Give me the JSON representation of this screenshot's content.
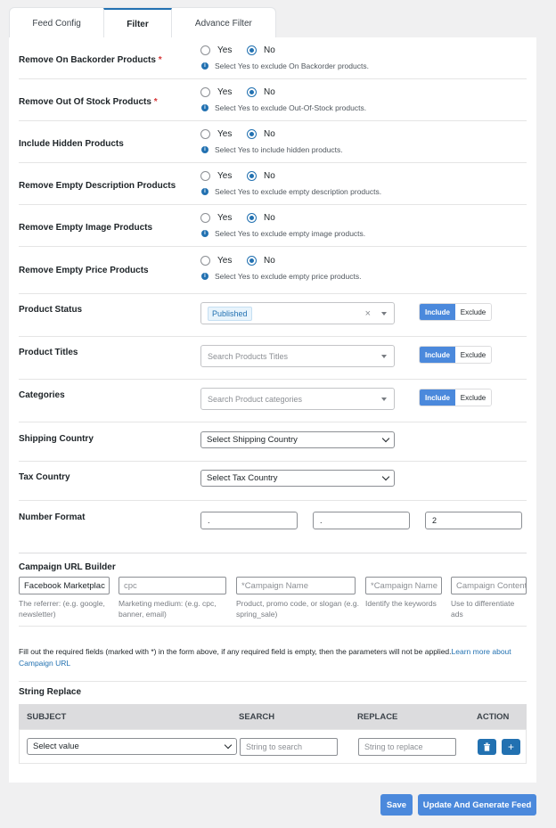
{
  "tabs": [
    "Feed Config",
    "Filter",
    "Advance Filter"
  ],
  "yes_no_rows": [
    {
      "label": "Remove On Backorder Products",
      "required": "*",
      "yes": "Yes",
      "no": "No",
      "selected": "No",
      "hint": "Select Yes to exclude On Backorder products."
    },
    {
      "label": "Remove Out Of Stock Products",
      "required": "*",
      "yes": "Yes",
      "no": "No",
      "selected": "No",
      "hint": "Select Yes to exclude Out-Of-Stock products."
    },
    {
      "label": "Include Hidden Products",
      "required": "",
      "yes": "Yes",
      "no": "No",
      "selected": "No",
      "hint": "Select Yes to include hidden products."
    },
    {
      "label": "Remove Empty Description Products",
      "required": "",
      "yes": "Yes",
      "no": "No",
      "selected": "No",
      "hint": "Select Yes to exclude empty description products."
    },
    {
      "label": "Remove Empty Image Products",
      "required": "",
      "yes": "Yes",
      "no": "No",
      "selected": "No",
      "hint": "Select Yes to exclude empty image products."
    },
    {
      "label": "Remove Empty Price Products",
      "required": "",
      "yes": "Yes",
      "no": "No",
      "selected": "No",
      "hint": "Select Yes to exclude empty price products."
    }
  ],
  "product_status": {
    "label": "Product Status",
    "tag": "Published",
    "clear": "×",
    "include": "Include",
    "exclude": "Exclude"
  },
  "product_titles": {
    "label": "Product Titles",
    "placeholder": "Search Products Titles",
    "include": "Include",
    "exclude": "Exclude"
  },
  "categories": {
    "label": "Categories",
    "placeholder": "Search Product categories",
    "include": "Include",
    "exclude": "Exclude"
  },
  "shipping_country": {
    "label": "Shipping Country",
    "value": "Select Shipping Country"
  },
  "tax_country": {
    "label": "Tax Country",
    "value": "Select Tax Country"
  },
  "number_format": {
    "label": "Number Format",
    "values": [
      ".",
      ".",
      "2"
    ]
  },
  "campaign": {
    "title": "Campaign URL Builder",
    "fields": [
      {
        "value": "Facebook Marketplac",
        "placeholder": "",
        "desc": "The referrer: (e.g. google, newsletter)"
      },
      {
        "value": "",
        "placeholder": "cpc",
        "desc": "Marketing medium: (e.g. cpc, banner, email)"
      },
      {
        "value": "",
        "placeholder": "*Campaign Name",
        "desc": "Product, promo code, or slogan (e.g. spring_sale)"
      },
      {
        "value": "",
        "placeholder": "*Campaign Name",
        "desc": "Identify the keywords"
      },
      {
        "value": "",
        "placeholder": "Campaign Content",
        "desc": "Use to differentiate ads"
      }
    ],
    "note": "Fill out the required fields (marked with *) in the form above, if any required field is empty, then the parameters will not be applied.",
    "note_link": "Learn more about Campaign URL"
  },
  "string_replace": {
    "title": "String Replace",
    "headers": [
      "SUBJECT",
      "SEARCH",
      "REPLACE",
      "ACTION"
    ],
    "subject_value": "Select value",
    "search_placeholder": "String to search",
    "replace_placeholder": "String to replace"
  },
  "buttons": {
    "save": "Save",
    "update": "Update And Generate Feed"
  },
  "colors": {
    "accent": "#2271b1",
    "button": "#4b89dc",
    "required": "#d63638"
  }
}
